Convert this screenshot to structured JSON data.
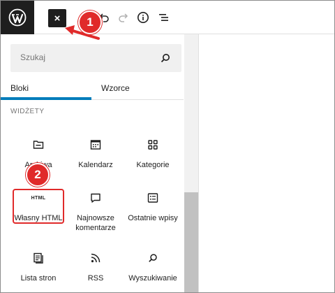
{
  "toolbar": {
    "close_label": "×",
    "logo_icon": "wordpress-logo",
    "tools": [
      "pencil-icon",
      "undo-icon",
      "redo-icon",
      "info-icon",
      "list-view-icon"
    ]
  },
  "callouts": {
    "one": "1",
    "two": "2"
  },
  "inserter": {
    "search_placeholder": "Szukaj",
    "tabs": [
      "Bloki",
      "Wzorce"
    ],
    "section_title": "WIDŻETY",
    "blocks": [
      {
        "label": "Archiwa",
        "icon": "folder-icon"
      },
      {
        "label": "Kalendarz",
        "icon": "calendar-icon"
      },
      {
        "label": "Kategorie",
        "icon": "categories-icon"
      },
      {
        "label": "Własny HTML",
        "icon": "html-icon",
        "badge": "HTML"
      },
      {
        "label": "Najnowsze komentarze",
        "icon": "comment-icon"
      },
      {
        "label": "Ostatnie wpisy",
        "icon": "post-list-icon"
      },
      {
        "label": "Lista stron",
        "icon": "page-list-icon"
      },
      {
        "label": "RSS",
        "icon": "rss-icon"
      },
      {
        "label": "Wyszukiwanie",
        "icon": "search-icon"
      }
    ]
  },
  "colors": {
    "accent": "#007cba",
    "callout": "#e02a2a",
    "dark": "#1e1e1e"
  }
}
